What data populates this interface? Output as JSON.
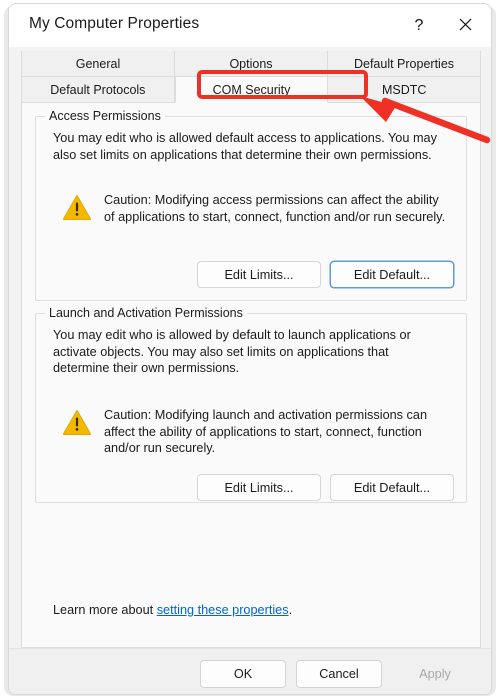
{
  "window": {
    "title": "My Computer Properties",
    "help_label": "?",
    "close_label": "✕"
  },
  "tabs": {
    "row1": [
      {
        "label": "General",
        "selected": false
      },
      {
        "label": "Options",
        "selected": false
      },
      {
        "label": "Default Properties",
        "selected": false
      }
    ],
    "row2": [
      {
        "label": "Default Protocols",
        "selected": false
      },
      {
        "label": "COM Security",
        "selected": true
      },
      {
        "label": "MSDTC",
        "selected": false
      }
    ]
  },
  "access_permissions": {
    "group_label": "Access Permissions",
    "description": "You may edit who is allowed default access to applications. You may also set limits on applications that determine their own permissions.",
    "caution": "Caution: Modifying access permissions can affect the ability of applications to start, connect, function and/or run securely.",
    "edit_limits_label": "Edit Limits...",
    "edit_default_label": "Edit Default..."
  },
  "launch_permissions": {
    "group_label": "Launch and Activation Permissions",
    "description": "You may edit who is allowed by default to launch applications or activate objects. You may also set limits on applications that determine their own permissions.",
    "caution": "Caution: Modifying launch and activation permissions can affect the ability of applications to start, connect, function and/or run securely.",
    "edit_limits_label": "Edit Limits...",
    "edit_default_label": "Edit Default..."
  },
  "learn_more": {
    "prefix": "Learn more about ",
    "link_text": "setting these properties",
    "suffix": "."
  },
  "footer": {
    "ok_label": "OK",
    "cancel_label": "Cancel",
    "apply_label": "Apply"
  },
  "colors": {
    "annotation": "#ee3124",
    "link": "#0066cc",
    "focus_ring": "#5a9fd4",
    "warning_icon": "#f5b800"
  }
}
